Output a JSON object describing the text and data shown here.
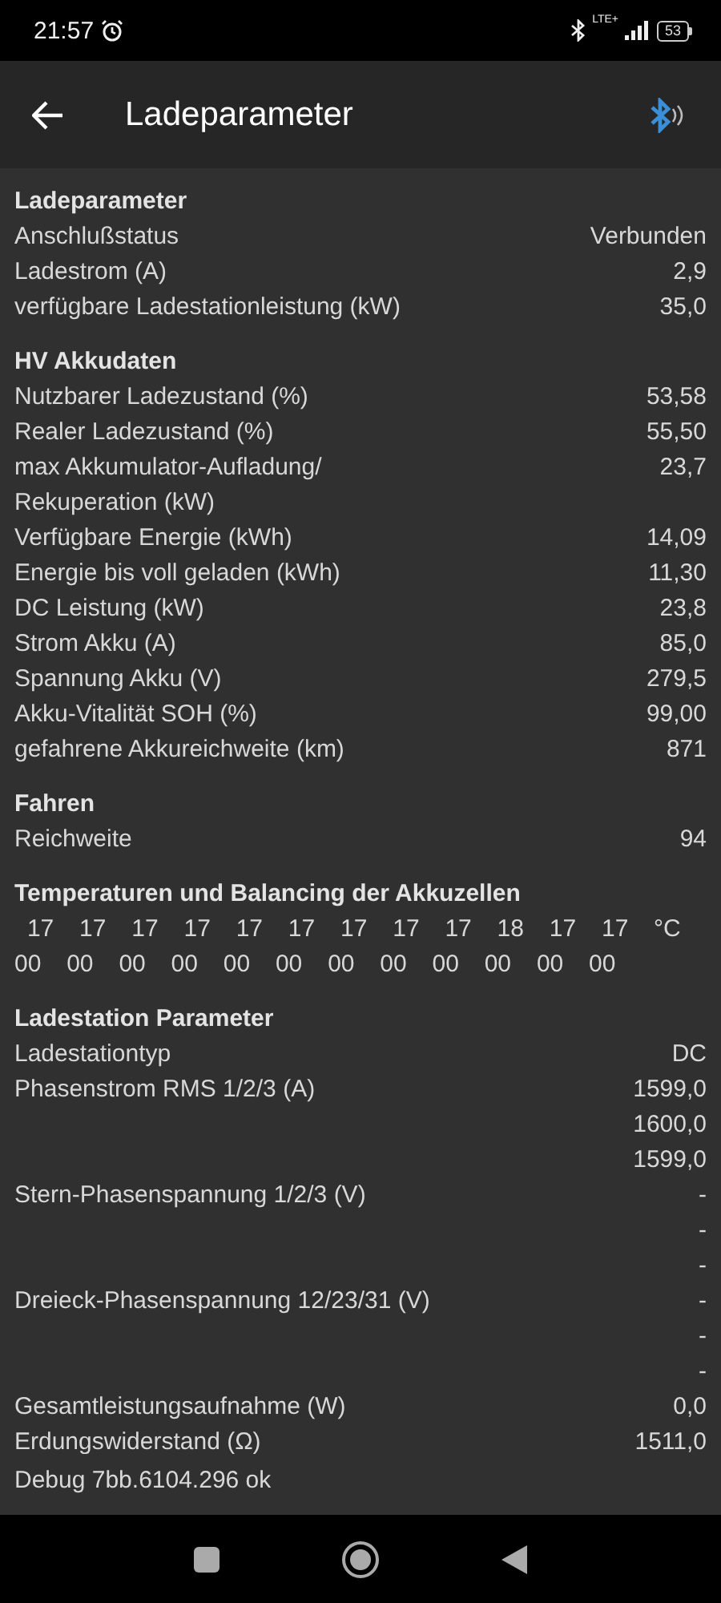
{
  "status_bar": {
    "time": "21:57",
    "network": "LTE+",
    "battery": "53"
  },
  "app_bar": {
    "title": "Ladeparameter"
  },
  "sections": [
    {
      "kind": "list",
      "title": "Ladeparameter",
      "rows": [
        {
          "label": "Anschlußstatus",
          "values": [
            "Verbunden"
          ]
        },
        {
          "label": "Ladestrom (A)",
          "values": [
            "2,9"
          ]
        },
        {
          "label": "verfügbare Ladestationleistung (kW)",
          "values": [
            "35,0"
          ]
        }
      ]
    },
    {
      "kind": "list",
      "title": "HV Akkudaten",
      "rows": [
        {
          "label": "Nutzbarer Ladezustand (%)",
          "values": [
            "53,58"
          ]
        },
        {
          "label": "Realer Ladezustand (%)",
          "values": [
            "55,50"
          ]
        },
        {
          "label": "max Akkumulator-Aufladung/\nRekuperation (kW)",
          "values": [
            "23,7"
          ]
        },
        {
          "label": "Verfügbare Energie (kWh)",
          "values": [
            "14,09"
          ]
        },
        {
          "label": "Energie bis voll geladen (kWh)",
          "values": [
            "11,30"
          ]
        },
        {
          "label": "DC Leistung (kW)",
          "values": [
            "23,8"
          ]
        },
        {
          "label": "Strom Akku (A)",
          "values": [
            "85,0"
          ]
        },
        {
          "label": "Spannung Akku (V)",
          "values": [
            "279,5"
          ]
        },
        {
          "label": "Akku-Vitalität SOH (%)",
          "values": [
            "99,00"
          ]
        },
        {
          "label": "gefahrene Akkureichweite (km)",
          "values": [
            "871"
          ]
        }
      ]
    },
    {
      "kind": "list",
      "title": "Fahren",
      "rows": [
        {
          "label": "Reichweite",
          "values": [
            "94"
          ]
        }
      ]
    },
    {
      "kind": "grid",
      "title": "Temperaturen und Balancing der Akkuzellen",
      "temperatures": [
        "17",
        "17",
        "17",
        "17",
        "17",
        "17",
        "17",
        "17",
        "17",
        "18",
        "17",
        "17"
      ],
      "unit": "°C",
      "balancing": [
        "00",
        "00",
        "00",
        "00",
        "00",
        "00",
        "00",
        "00",
        "00",
        "00",
        "00",
        "00"
      ]
    },
    {
      "kind": "list",
      "title": "Ladestation Parameter",
      "rows": [
        {
          "label": "Ladestationtyp",
          "values": [
            "DC"
          ]
        },
        {
          "label": "Phasenstrom RMS 1/2/3 (A)",
          "values": [
            "1599,0",
            "1600,0",
            "1599,0"
          ]
        },
        {
          "label": "Stern-Phasenspannung 1/2/3 (V)",
          "values": [
            "-",
            "-",
            "-"
          ]
        },
        {
          "label": "Dreieck-Phasenspannung 12/23/31 (V)",
          "values": [
            "-",
            "-",
            "-"
          ]
        },
        {
          "label": "Gesamtleistungsaufnahme (W)",
          "values": [
            "0,0"
          ]
        },
        {
          "label": "Erdungswiderstand (Ω)",
          "values": [
            "1511,0"
          ]
        }
      ]
    }
  ],
  "footer": {
    "debug": "Debug 7bb.6104.296 ok"
  }
}
